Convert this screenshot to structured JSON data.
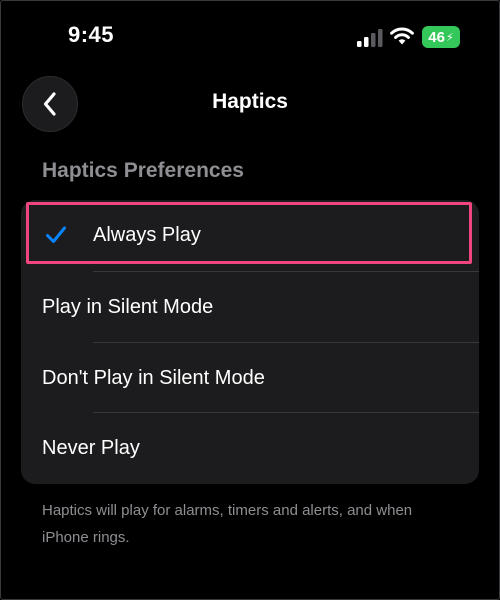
{
  "status_bar": {
    "time": "9:45",
    "battery_level": "46",
    "icons": [
      "cellular-signal-icon",
      "wifi-icon",
      "battery-charging-icon"
    ]
  },
  "nav": {
    "back_icon": "chevron-left-icon",
    "title": "Haptics"
  },
  "section": {
    "header": "Haptics Preferences",
    "options": [
      {
        "label": "Always Play",
        "selected": true
      },
      {
        "label": "Play in Silent Mode",
        "selected": false
      },
      {
        "label": "Don't Play in Silent Mode",
        "selected": false
      },
      {
        "label": "Never Play",
        "selected": false
      }
    ],
    "footer": "Haptics will play for alarms, timers and alerts, and when iPhone rings."
  },
  "colors": {
    "background": "#000000",
    "card": "#1c1c1e",
    "accent_checkmark": "#0a84ff",
    "battery": "#34c759",
    "highlight_annotation": "#f0457e",
    "secondary_text": "#8e8e93"
  }
}
